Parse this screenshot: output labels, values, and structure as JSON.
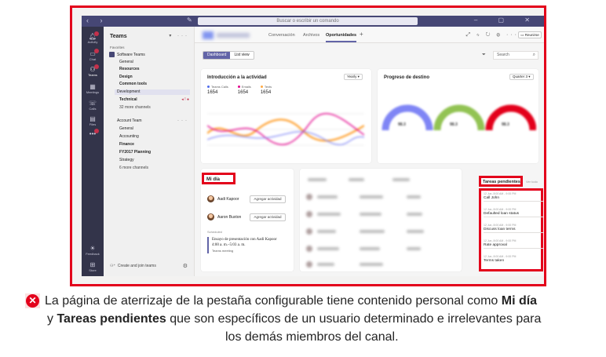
{
  "titlebar": {
    "search_placeholder": "Buscar o escribir un comando"
  },
  "rail": {
    "items": [
      {
        "label": "Activity",
        "icon": "bell-icon",
        "badge": true
      },
      {
        "label": "Chat",
        "icon": "chat-icon",
        "badge": true
      },
      {
        "label": "Teams",
        "icon": "teams-icon",
        "badge": true,
        "active": true
      },
      {
        "label": "Meetings",
        "icon": "calendar-icon"
      },
      {
        "label": "Calls",
        "icon": "phone-icon"
      },
      {
        "label": "Files",
        "icon": "files-icon"
      },
      {
        "label": "",
        "icon": "more-icon",
        "badge": true
      },
      {
        "label": "Feedback",
        "icon": "lightbulb-icon"
      },
      {
        "label": "Store",
        "icon": "store-icon"
      }
    ]
  },
  "teams_panel": {
    "title": "Teams",
    "favorites_label": "Favorites",
    "team1": {
      "name": "Software Teams",
      "channels": [
        "General",
        "Resources",
        "Design",
        "Common tools",
        "Development",
        "Technical",
        "32 more channels"
      ]
    },
    "team2": {
      "name": "Account Team",
      "channels": [
        "General",
        "Accounting",
        "Finance",
        "FY2017 Planning",
        "Strategy",
        "6 more channels"
      ]
    },
    "join_label": "Create and join teams"
  },
  "content": {
    "tabs": [
      "Conversación",
      "Archivos",
      "Oportunidades"
    ],
    "active_tab": "Oportunidades",
    "meet_label": "Reunirse",
    "views": [
      "Dashboard",
      "List view"
    ],
    "search_label": "Search"
  },
  "intro_card": {
    "title": "Introducción a la actividad",
    "dropdown": "Yearly",
    "legend": [
      {
        "label": "Teams Calls",
        "value": "1654",
        "color": "#4f6bed"
      },
      {
        "label": "Emails",
        "value": "1654",
        "color": "#e3008c"
      },
      {
        "label": "Texts",
        "value": "1654",
        "color": "#ffaa44"
      }
    ]
  },
  "progress_card": {
    "title": "Progreso de destino",
    "dropdown": "Quarter 3",
    "gauges": [
      {
        "value": "98.3",
        "color": "#7f85f5"
      },
      {
        "value": "98.3",
        "color": "#92c353"
      },
      {
        "value": "98.3",
        "color": "#e3001b"
      }
    ]
  },
  "mi_dia": {
    "title": "Mi día",
    "people": [
      {
        "name": "Aadi Kapoor",
        "action": "Agregar actividad"
      },
      {
        "name": "Aaron Buxton",
        "action": "Agregar actividad"
      }
    ],
    "scheduled_label": "Scheduled",
    "meeting": {
      "title": "Ensayo de presentación con Aadi Kapoor",
      "time": "4:00 a. m.–5:03 a. m.",
      "type": "Teams meeting"
    }
  },
  "tareas": {
    "title": "Tareas pendientes",
    "see_all": "Ver todo",
    "items": [
      {
        "time": "12 Jun, 8:00 AM - 9:00 PM",
        "name": "Call John"
      },
      {
        "time": "12 Jun, 8:00 AM - 9:00 PM",
        "name": "Defaulted loan status"
      },
      {
        "time": "12 Jun, 8:00 AM - 9:00 PM",
        "name": "Discuss loan terms"
      },
      {
        "time": "12 Jun, 8:00 AM - 9:00 PM",
        "name": "Rate approval"
      },
      {
        "time": "12 Jun, 8:00 AM - 9:00 PM",
        "name": "Terms taken"
      }
    ]
  },
  "caption": {
    "line1_a": "La página de aterrizaje de la pestaña configurable tiene contenido personal como ",
    "line1_b": "Mi día",
    "line2_a": "y ",
    "line2_b": "Tareas pendientes",
    "line2_c": " que son específicos de un usuario determinado e irrelevantes para",
    "line3": "los demás miembros del canal."
  },
  "colors": {
    "highlight": "#e3001b",
    "rail": "#33344a",
    "titlebar": "#464775",
    "accent": "#6264a7"
  }
}
